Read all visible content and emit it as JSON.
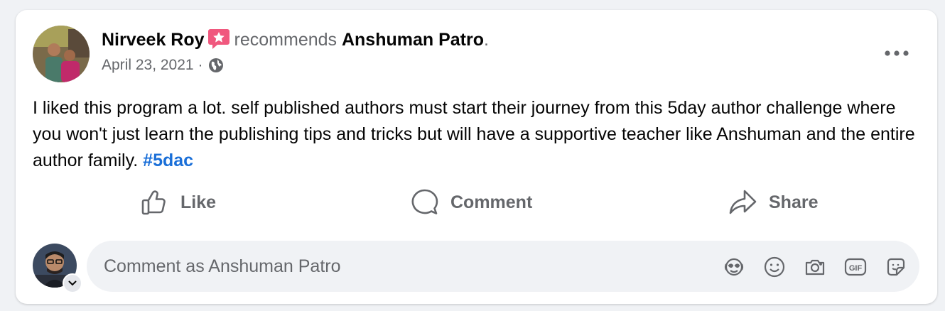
{
  "post": {
    "author": "Nirveek Roy",
    "verb": "recommends",
    "target": "Anshuman Patro",
    "target_suffix": ".",
    "date": "April 23, 2021",
    "date_sep": "·",
    "privacy_icon": "globe-icon",
    "more_icon": "more-horizontal-icon",
    "body": "I liked this program a lot. self published authors must start their journey from this 5day author challenge where you won't just learn the publishing tips and tricks but will have a supportive teacher like Anshuman and the entire author family.",
    "hashtag": "#5dac"
  },
  "actions": {
    "like": "Like",
    "comment": "Comment",
    "share": "Share"
  },
  "composer": {
    "placeholder": "Comment as Anshuman Patro",
    "icons": [
      "avatar-sticker-icon",
      "emoji-icon",
      "camera-icon",
      "gif-icon",
      "sticker-icon"
    ]
  },
  "colors": {
    "background": "#f0f2f5",
    "card": "#ffffff",
    "text_primary": "#050505",
    "text_secondary": "#65676b",
    "hashtag": "#1a6fd8",
    "recommend_badge": "#f0587e"
  }
}
